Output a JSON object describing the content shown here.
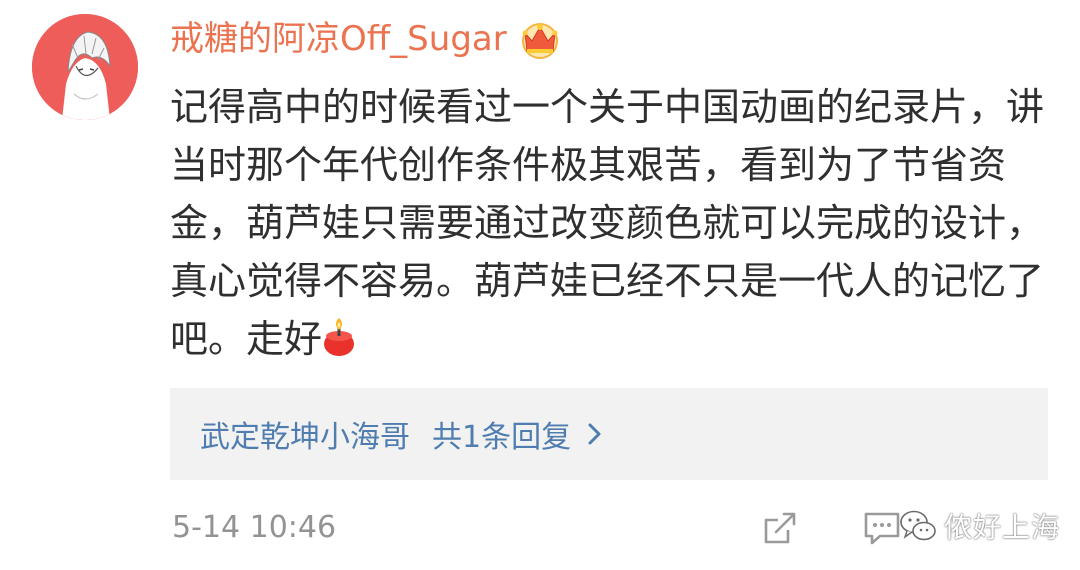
{
  "comment": {
    "username": "戒糖的阿凉Off_Sugar",
    "user_badge_icon": "crown-icon",
    "body_text": "记得高中的时候看过一个关于中国动画的纪录片，讲当时那个年代创作条件极其艰苦，看到为了节省资金，葫芦娃只需要通过改变颜色就可以完成的设计，真心觉得不容易。葫芦娃已经不只是一代人的记忆了吧。走好",
    "trailing_emoji": "candle-icon",
    "timestamp": "5-14 10:46"
  },
  "reply_summary": {
    "reply_user": "武定乾坤小海哥",
    "reply_count_text": "共1条回复",
    "chevron_icon": "chevron-right-icon"
  },
  "actions": {
    "share_icon": "share-icon",
    "reply_icon": "comment-icon"
  },
  "watermark": {
    "text": "侬好上海",
    "logo_icon": "wechat-logo-icon"
  },
  "colors": {
    "username": "#eb7350",
    "body_text": "#2f2f2f",
    "link_blue": "#507daf",
    "reply_bg": "#f2f2f2",
    "timestamp": "#939393",
    "avatar_bg": "#ee5d5a"
  }
}
